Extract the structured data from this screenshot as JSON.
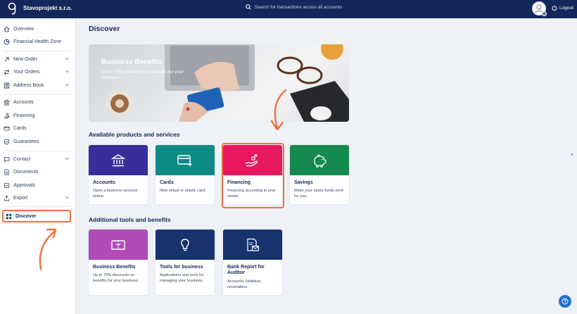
{
  "header": {
    "company": "Stavoprojekt s.r.o.",
    "search_placeholder": "Search for transactions across all accounts",
    "logout_label": "Logout"
  },
  "sidebar": {
    "items": [
      {
        "label": "Overview",
        "icon": "home-icon"
      },
      {
        "label": "Financial Health Zone",
        "icon": "health-zone-icon"
      },
      {
        "label": "New Order",
        "icon": "arrow-up-right-icon"
      },
      {
        "label": "Your Orders",
        "icon": "arrows-icon"
      },
      {
        "label": "Address Book",
        "icon": "address-book-icon"
      },
      {
        "label": "Accounts",
        "icon": "bank-icon"
      },
      {
        "label": "Financing",
        "icon": "financing-icon"
      },
      {
        "label": "Cards",
        "icon": "card-icon"
      },
      {
        "label": "Guarantees",
        "icon": "shield-icon"
      },
      {
        "label": "Contact",
        "icon": "chat-icon"
      },
      {
        "label": "Documents",
        "icon": "document-icon"
      },
      {
        "label": "Approvals",
        "icon": "approvals-icon"
      },
      {
        "label": "Export",
        "icon": "export-icon"
      },
      {
        "label": "Discover",
        "icon": "grid-icon"
      }
    ]
  },
  "main": {
    "title": "Discover",
    "banner": {
      "title": "Business Benefits",
      "subtitle": "Up to 70% discounts on benefits for your business"
    },
    "products_title": "Available products and services",
    "products": [
      {
        "title": "Accounts",
        "desc": "Open a business account online.",
        "color": "#3a2d9a"
      },
      {
        "title": "Cards",
        "desc": "New virtual or plastic card.",
        "color": "#0f8b86"
      },
      {
        "title": "Financing",
        "desc": "Financing according to your needs.",
        "color": "#e8185f"
      },
      {
        "title": "Savings",
        "desc": "Make your spare funds work for you.",
        "color": "#168a4e"
      }
    ],
    "tools_title": "Additional tools and benefits",
    "tools": [
      {
        "title": "Business Benefits",
        "desc": "Up to 70% discounts on benefits for your business.",
        "color": "#b24bb8"
      },
      {
        "title": "Tools for business",
        "desc": "Applications and tools for managing your business.",
        "color": "#16336e"
      },
      {
        "title": "Bank Report for Auditor",
        "desc": "Accounts, liabilities, receivables.",
        "color": "#16336e"
      }
    ]
  },
  "colors": {
    "topbar": "#13275a",
    "highlight": "#f0703e",
    "accent_blue": "#1f6ed4"
  }
}
